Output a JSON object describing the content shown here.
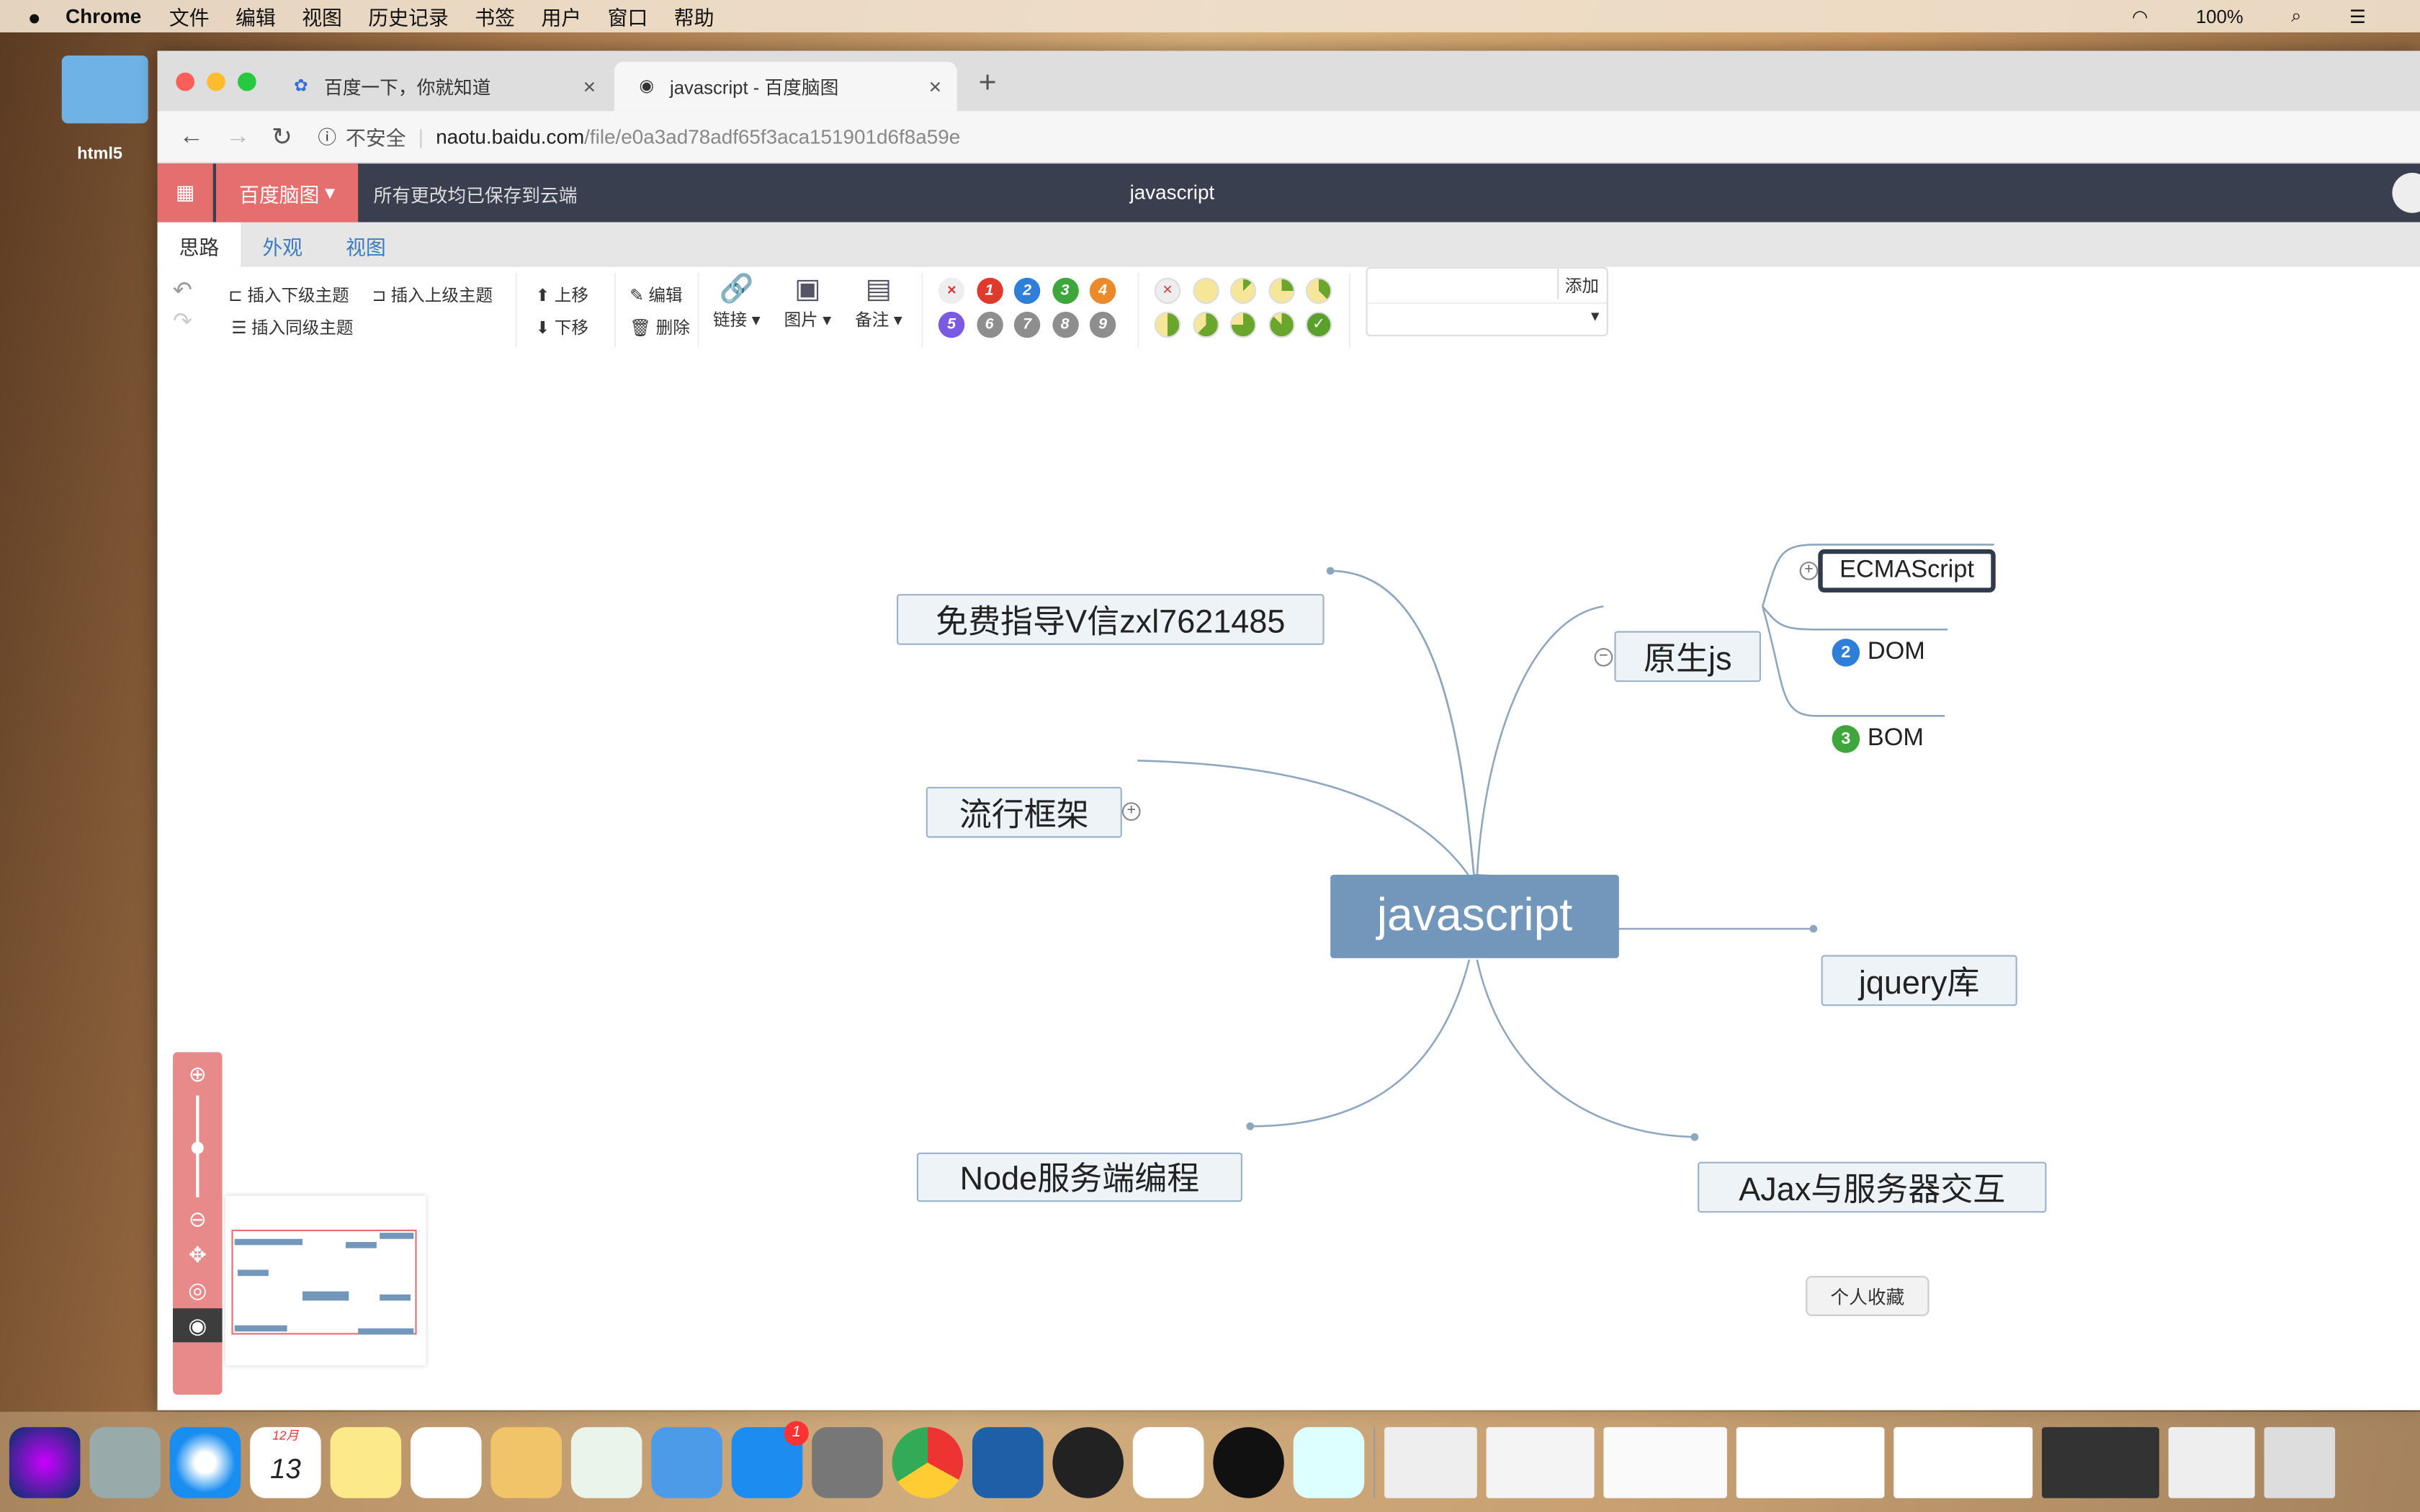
{
  "menubar": {
    "app": "Chrome",
    "items": [
      "文件",
      "编辑",
      "视图",
      "历史记录",
      "书签",
      "用户",
      "窗口",
      "帮助"
    ],
    "battery": "100%"
  },
  "desktop": {
    "folder": "html5"
  },
  "browser": {
    "tabs": [
      {
        "title": "百度一下，你就知道",
        "active": false
      },
      {
        "title": "javascript - 百度脑图",
        "active": true
      }
    ],
    "security": "不安全",
    "url_host": "naotu.baidu.com",
    "url_path": "/file/e0a3ad78adf65f3aca151901d6f8a59e"
  },
  "app": {
    "brand": "百度脑图",
    "saved_status": "所有更改均已保存到云端",
    "doc_title": "javascript",
    "accent": "#e56f6f"
  },
  "ribbon_tabs": [
    "思路",
    "外观",
    "视图"
  ],
  "toolbar": {
    "insert_child": "插入下级主题",
    "insert_parent": "插入上级主题",
    "insert_sibling": "插入同级主题",
    "move_up": "上移",
    "move_down": "下移",
    "edit": "编辑",
    "delete": "删除",
    "link": "链接",
    "image": "图片",
    "note": "备注",
    "add": "添加",
    "priorities": [
      "1",
      "2",
      "3",
      "4",
      "5",
      "6",
      "7",
      "8",
      "9"
    ],
    "priority_colors": [
      "#e03a2e",
      "#2f7fd8",
      "#3ea63a",
      "#ea8a2a",
      "#7a5ae0",
      "#8e8e8e",
      "#8e8e8e",
      "#8e8e8e",
      "#8e8e8e"
    ],
    "progress_levels": [
      0,
      0,
      0.125,
      0.25,
      0.375,
      0.5,
      0.625,
      0.75,
      0.875,
      1
    ]
  },
  "mindmap": {
    "root": "javascript",
    "nodes": {
      "wechat": "免费指导V信zxl7621485",
      "frameworks": "流行框架",
      "node": "Node服务端编程",
      "native": "原生js",
      "ecma": "ECMAScript",
      "dom": "DOM",
      "bom": "BOM",
      "jquery": "jquery库",
      "ajax": "AJax与服务器交互"
    },
    "dom_priority": "2",
    "bom_priority": "3"
  },
  "dock": {
    "tooltip": "个人收藏",
    "calendar_month": "12月",
    "calendar_day": "13",
    "appstore_badge": "1"
  }
}
